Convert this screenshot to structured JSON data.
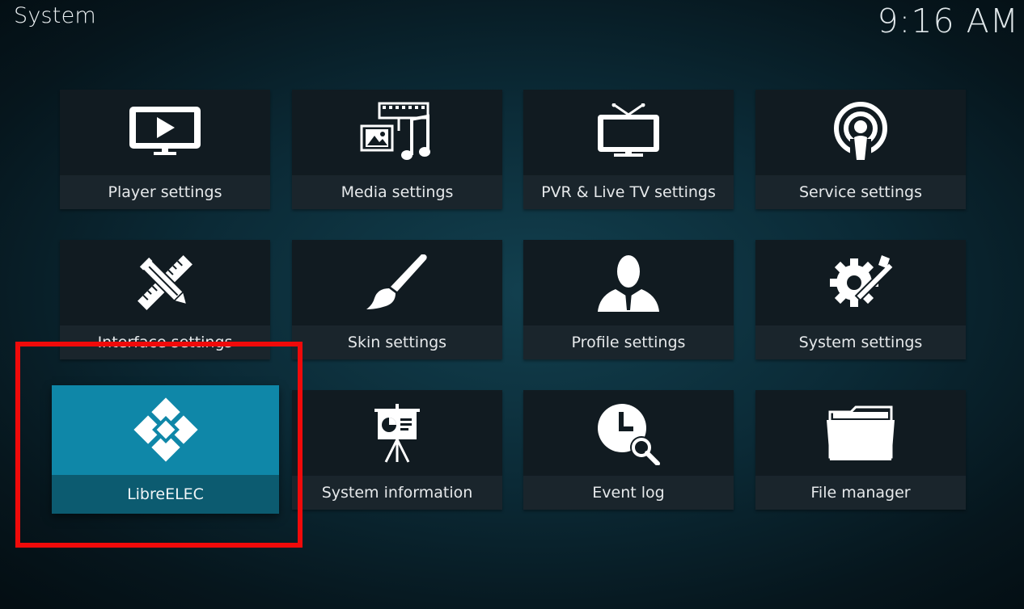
{
  "header": {
    "title": "System",
    "clock": "9:16 AM"
  },
  "tiles": [
    {
      "label": "Player settings",
      "icon": "tv-play-icon"
    },
    {
      "label": "Media settings",
      "icon": "media-icon"
    },
    {
      "label": "PVR & Live TV settings",
      "icon": "tv-antenna-icon"
    },
    {
      "label": "Service settings",
      "icon": "podcast-icon"
    },
    {
      "label": "Interface settings",
      "icon": "pencil-ruler-icon"
    },
    {
      "label": "Skin settings",
      "icon": "paintbrush-icon"
    },
    {
      "label": "Profile settings",
      "icon": "user-icon"
    },
    {
      "label": "System settings",
      "icon": "gear-tools-icon"
    },
    {
      "label": "LibreELEC",
      "icon": "libreelec-logo-icon",
      "focused": true
    },
    {
      "label": "System information",
      "icon": "presentation-icon"
    },
    {
      "label": "Event log",
      "icon": "clock-search-icon"
    },
    {
      "label": "File manager",
      "icon": "folder-icon"
    }
  ],
  "colors": {
    "focus_tile": "#0f87a8",
    "focus_label": "#0c5b70",
    "tile": "#111b21",
    "highlight_box": "#f00a0a"
  }
}
